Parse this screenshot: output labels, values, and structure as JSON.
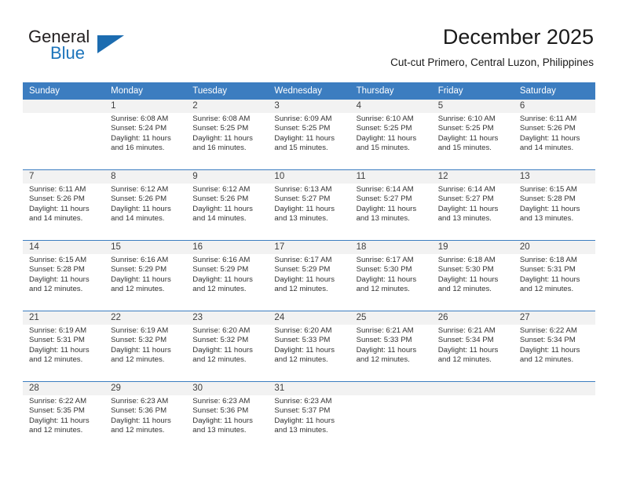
{
  "logo": {
    "word_top": "General",
    "word_bottom": "Blue",
    "accent_color": "#1c6cb0",
    "triangle_icon": "triangle-icon"
  },
  "header": {
    "title": "December 2025",
    "subtitle": "Cut-cut Primero, Central Luzon, Philippines"
  },
  "theme": {
    "header_bg": "#3c7dc0",
    "daynum_bg": "#f2f2f2",
    "grid_line": "#3c7dc0"
  },
  "weekday_headers": [
    "Sunday",
    "Monday",
    "Tuesday",
    "Wednesday",
    "Thursday",
    "Friday",
    "Saturday"
  ],
  "weeks": [
    [
      {
        "day": "",
        "lines": []
      },
      {
        "day": "1",
        "lines": [
          "Sunrise: 6:08 AM",
          "Sunset: 5:24 PM",
          "Daylight: 11 hours",
          "and 16 minutes."
        ]
      },
      {
        "day": "2",
        "lines": [
          "Sunrise: 6:08 AM",
          "Sunset: 5:25 PM",
          "Daylight: 11 hours",
          "and 16 minutes."
        ]
      },
      {
        "day": "3",
        "lines": [
          "Sunrise: 6:09 AM",
          "Sunset: 5:25 PM",
          "Daylight: 11 hours",
          "and 15 minutes."
        ]
      },
      {
        "day": "4",
        "lines": [
          "Sunrise: 6:10 AM",
          "Sunset: 5:25 PM",
          "Daylight: 11 hours",
          "and 15 minutes."
        ]
      },
      {
        "day": "5",
        "lines": [
          "Sunrise: 6:10 AM",
          "Sunset: 5:25 PM",
          "Daylight: 11 hours",
          "and 15 minutes."
        ]
      },
      {
        "day": "6",
        "lines": [
          "Sunrise: 6:11 AM",
          "Sunset: 5:26 PM",
          "Daylight: 11 hours",
          "and 14 minutes."
        ]
      }
    ],
    [
      {
        "day": "7",
        "lines": [
          "Sunrise: 6:11 AM",
          "Sunset: 5:26 PM",
          "Daylight: 11 hours",
          "and 14 minutes."
        ]
      },
      {
        "day": "8",
        "lines": [
          "Sunrise: 6:12 AM",
          "Sunset: 5:26 PM",
          "Daylight: 11 hours",
          "and 14 minutes."
        ]
      },
      {
        "day": "9",
        "lines": [
          "Sunrise: 6:12 AM",
          "Sunset: 5:26 PM",
          "Daylight: 11 hours",
          "and 14 minutes."
        ]
      },
      {
        "day": "10",
        "lines": [
          "Sunrise: 6:13 AM",
          "Sunset: 5:27 PM",
          "Daylight: 11 hours",
          "and 13 minutes."
        ]
      },
      {
        "day": "11",
        "lines": [
          "Sunrise: 6:14 AM",
          "Sunset: 5:27 PM",
          "Daylight: 11 hours",
          "and 13 minutes."
        ]
      },
      {
        "day": "12",
        "lines": [
          "Sunrise: 6:14 AM",
          "Sunset: 5:27 PM",
          "Daylight: 11 hours",
          "and 13 minutes."
        ]
      },
      {
        "day": "13",
        "lines": [
          "Sunrise: 6:15 AM",
          "Sunset: 5:28 PM",
          "Daylight: 11 hours",
          "and 13 minutes."
        ]
      }
    ],
    [
      {
        "day": "14",
        "lines": [
          "Sunrise: 6:15 AM",
          "Sunset: 5:28 PM",
          "Daylight: 11 hours",
          "and 12 minutes."
        ]
      },
      {
        "day": "15",
        "lines": [
          "Sunrise: 6:16 AM",
          "Sunset: 5:29 PM",
          "Daylight: 11 hours",
          "and 12 minutes."
        ]
      },
      {
        "day": "16",
        "lines": [
          "Sunrise: 6:16 AM",
          "Sunset: 5:29 PM",
          "Daylight: 11 hours",
          "and 12 minutes."
        ]
      },
      {
        "day": "17",
        "lines": [
          "Sunrise: 6:17 AM",
          "Sunset: 5:29 PM",
          "Daylight: 11 hours",
          "and 12 minutes."
        ]
      },
      {
        "day": "18",
        "lines": [
          "Sunrise: 6:17 AM",
          "Sunset: 5:30 PM",
          "Daylight: 11 hours",
          "and 12 minutes."
        ]
      },
      {
        "day": "19",
        "lines": [
          "Sunrise: 6:18 AM",
          "Sunset: 5:30 PM",
          "Daylight: 11 hours",
          "and 12 minutes."
        ]
      },
      {
        "day": "20",
        "lines": [
          "Sunrise: 6:18 AM",
          "Sunset: 5:31 PM",
          "Daylight: 11 hours",
          "and 12 minutes."
        ]
      }
    ],
    [
      {
        "day": "21",
        "lines": [
          "Sunrise: 6:19 AM",
          "Sunset: 5:31 PM",
          "Daylight: 11 hours",
          "and 12 minutes."
        ]
      },
      {
        "day": "22",
        "lines": [
          "Sunrise: 6:19 AM",
          "Sunset: 5:32 PM",
          "Daylight: 11 hours",
          "and 12 minutes."
        ]
      },
      {
        "day": "23",
        "lines": [
          "Sunrise: 6:20 AM",
          "Sunset: 5:32 PM",
          "Daylight: 11 hours",
          "and 12 minutes."
        ]
      },
      {
        "day": "24",
        "lines": [
          "Sunrise: 6:20 AM",
          "Sunset: 5:33 PM",
          "Daylight: 11 hours",
          "and 12 minutes."
        ]
      },
      {
        "day": "25",
        "lines": [
          "Sunrise: 6:21 AM",
          "Sunset: 5:33 PM",
          "Daylight: 11 hours",
          "and 12 minutes."
        ]
      },
      {
        "day": "26",
        "lines": [
          "Sunrise: 6:21 AM",
          "Sunset: 5:34 PM",
          "Daylight: 11 hours",
          "and 12 minutes."
        ]
      },
      {
        "day": "27",
        "lines": [
          "Sunrise: 6:22 AM",
          "Sunset: 5:34 PM",
          "Daylight: 11 hours",
          "and 12 minutes."
        ]
      }
    ],
    [
      {
        "day": "28",
        "lines": [
          "Sunrise: 6:22 AM",
          "Sunset: 5:35 PM",
          "Daylight: 11 hours",
          "and 12 minutes."
        ]
      },
      {
        "day": "29",
        "lines": [
          "Sunrise: 6:23 AM",
          "Sunset: 5:36 PM",
          "Daylight: 11 hours",
          "and 12 minutes."
        ]
      },
      {
        "day": "30",
        "lines": [
          "Sunrise: 6:23 AM",
          "Sunset: 5:36 PM",
          "Daylight: 11 hours",
          "and 13 minutes."
        ]
      },
      {
        "day": "31",
        "lines": [
          "Sunrise: 6:23 AM",
          "Sunset: 5:37 PM",
          "Daylight: 11 hours",
          "and 13 minutes."
        ]
      },
      {
        "day": "",
        "lines": []
      },
      {
        "day": "",
        "lines": []
      },
      {
        "day": "",
        "lines": []
      }
    ]
  ]
}
